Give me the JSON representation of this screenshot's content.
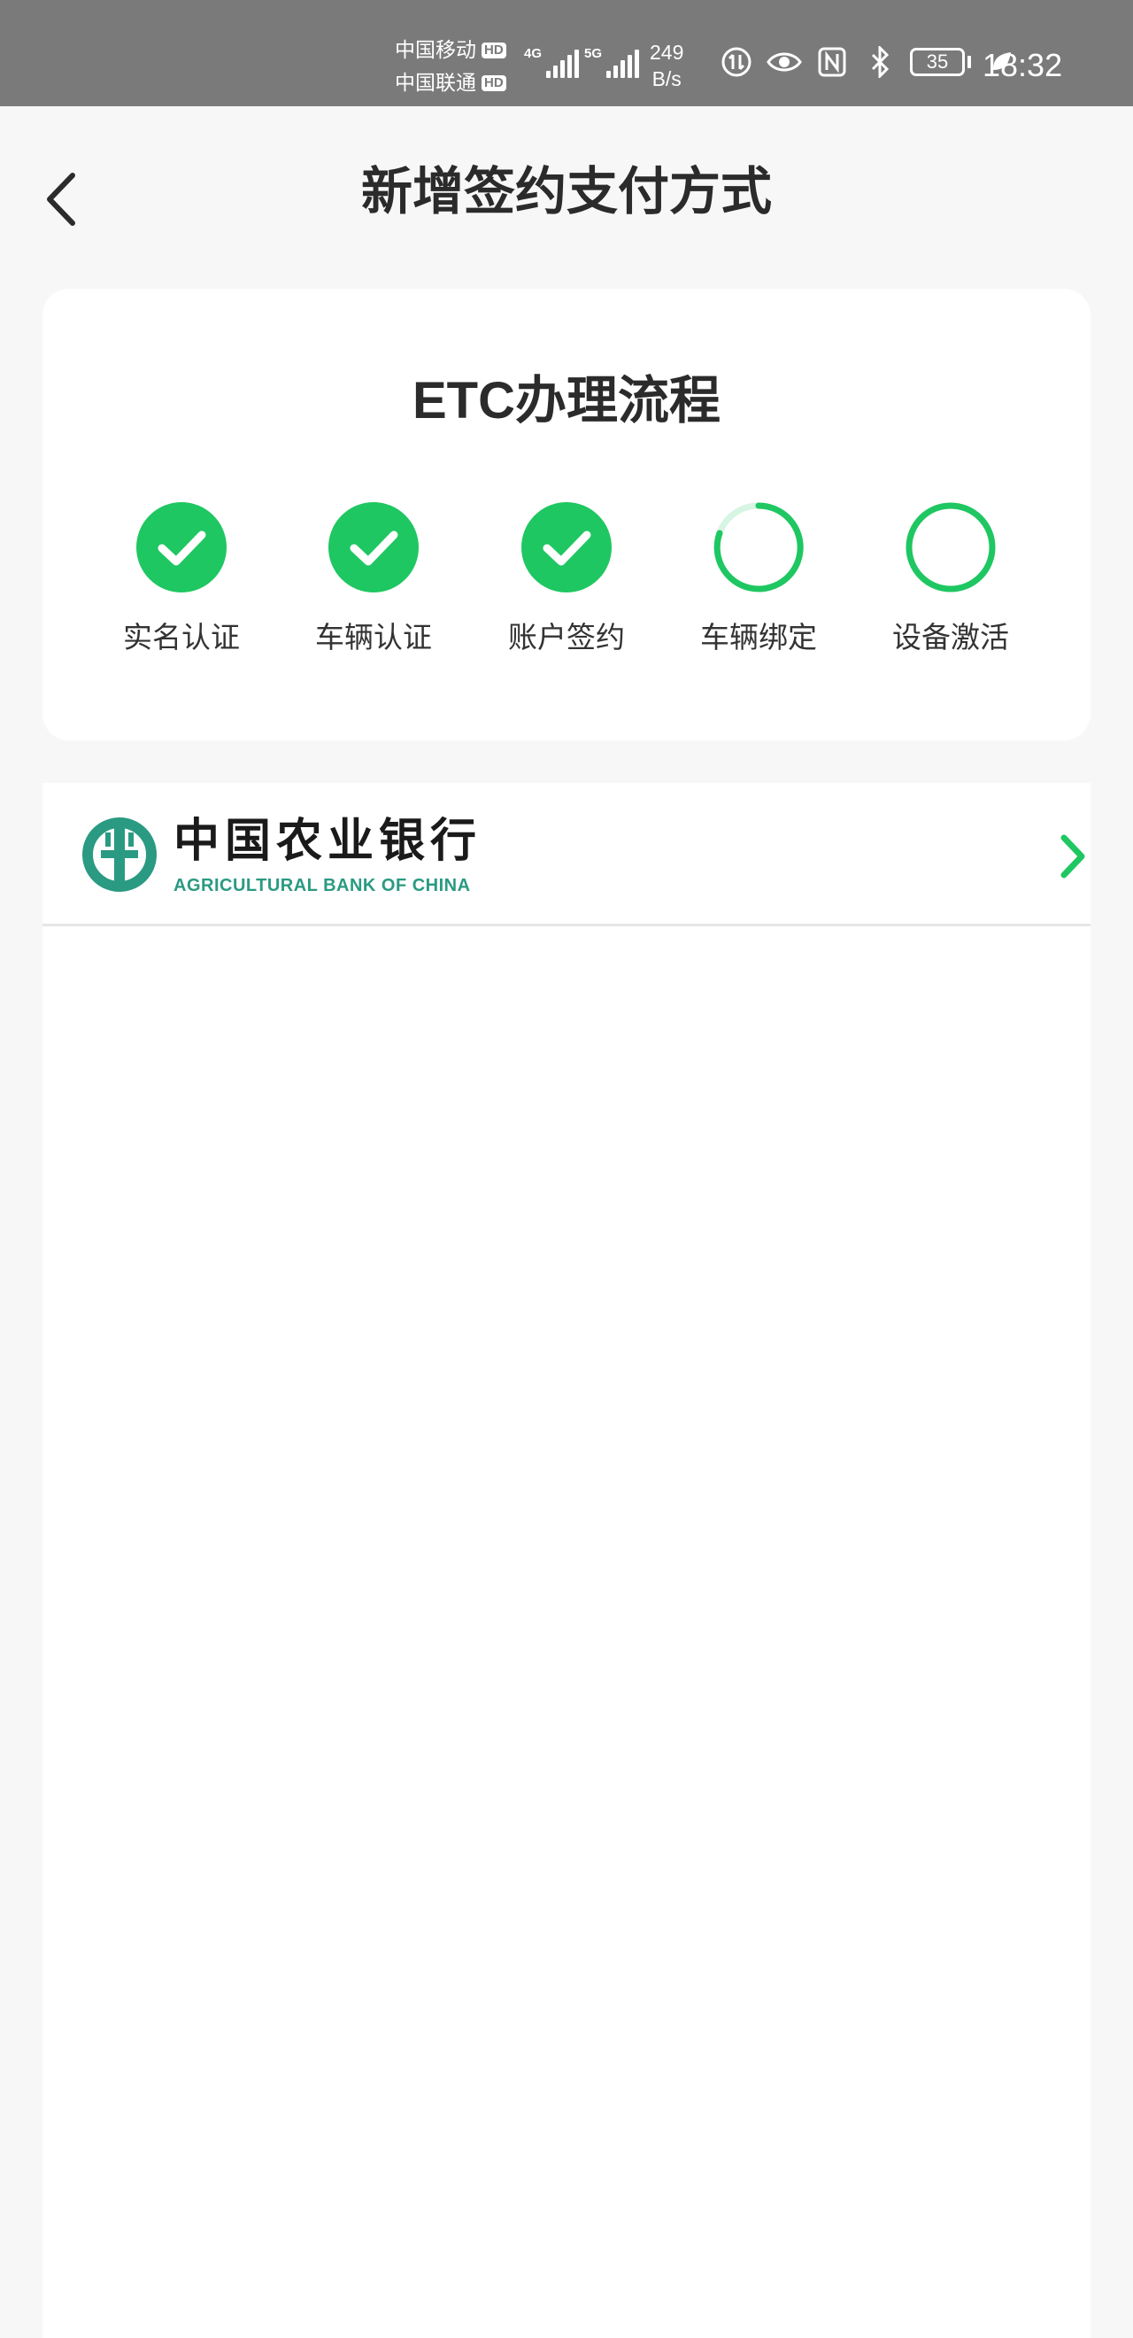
{
  "status_bar": {
    "carrier1": "中国移动",
    "carrier2": "中国联通",
    "hd_label": "HD",
    "net1": "4G",
    "net2": "5G",
    "speed_value": "249",
    "speed_unit": "B/s",
    "battery": "35",
    "time": "18:32",
    "icons": [
      "data-saver-icon",
      "eye-comfort-icon",
      "nfc-icon",
      "bluetooth-icon",
      "battery-icon",
      "leaf-icon"
    ]
  },
  "header": {
    "back_icon": "chevron-left-icon",
    "title": "新增签约支付方式"
  },
  "flow": {
    "title": "ETC办理流程",
    "accent_color": "#1ec761",
    "steps": [
      {
        "label": "实名认证",
        "status": "done"
      },
      {
        "label": "车辆认证",
        "status": "done"
      },
      {
        "label": "账户签约",
        "status": "done"
      },
      {
        "label": "车辆绑定",
        "status": "in-progress"
      },
      {
        "label": "设备激活",
        "status": "pending"
      }
    ]
  },
  "bank": {
    "name_cn": "中国农业银行",
    "name_en": "AGRICULTURAL BANK OF CHINA",
    "logo_color": "#2a9a82",
    "chevron_icon": "chevron-right-icon"
  }
}
